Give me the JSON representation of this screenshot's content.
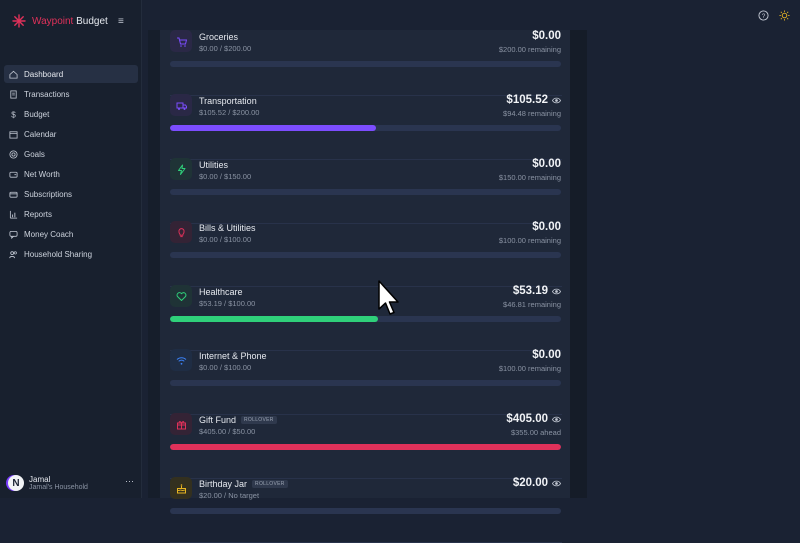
{
  "brand": {
    "name_accent": "Waypoint",
    "name_rest": " Budget"
  },
  "nav": [
    {
      "label": "Dashboard",
      "icon": "home-icon",
      "active": true
    },
    {
      "label": "Transactions",
      "icon": "receipt-icon"
    },
    {
      "label": "Budget",
      "icon": "dollar-icon"
    },
    {
      "label": "Calendar",
      "icon": "calendar-icon"
    },
    {
      "label": "Goals",
      "icon": "target-icon"
    },
    {
      "label": "Net Worth",
      "icon": "wallet-icon"
    },
    {
      "label": "Subscriptions",
      "icon": "card-icon"
    },
    {
      "label": "Reports",
      "icon": "chart-icon"
    },
    {
      "label": "Money Coach",
      "icon": "chat-icon"
    },
    {
      "label": "Household Sharing",
      "icon": "users-icon"
    }
  ],
  "user": {
    "initial": "N",
    "name": "Jamal",
    "household": "Jamal's Household"
  },
  "categories": [
    {
      "name": "Groceries",
      "spent": "$0.00 / $200.00",
      "amount": "$0.00",
      "remaining": "$200.00 remaining",
      "progress": 0,
      "color": "#7c4dff",
      "icon": "cart-icon",
      "icon_bg": "#2a2846"
    },
    {
      "name": "Transportation",
      "spent": "$105.52 / $200.00",
      "amount": "$105.52",
      "remaining": "$94.48 remaining",
      "progress": 0.5276,
      "color": "#7c4dff",
      "icon": "truck-icon",
      "icon_bg": "#2a2846",
      "eye": true
    },
    {
      "name": "Utilities",
      "spent": "$0.00 / $150.00",
      "amount": "$0.00",
      "remaining": "$150.00 remaining",
      "progress": 0,
      "color": "#2fd07a",
      "icon": "bolt-icon",
      "icon_bg": "#1f3336"
    },
    {
      "name": "Bills & Utilities",
      "spent": "$0.00 / $100.00",
      "amount": "$0.00",
      "remaining": "$100.00 remaining",
      "progress": 0,
      "color": "#e0315a",
      "icon": "bulb-icon",
      "icon_bg": "#342335"
    },
    {
      "name": "Healthcare",
      "spent": "$53.19 / $100.00",
      "amount": "$53.19",
      "remaining": "$46.81 remaining",
      "progress": 0.5319,
      "color": "#2fd07a",
      "icon": "heart-icon",
      "icon_bg": "#1f3336",
      "eye": true
    },
    {
      "name": "Internet & Phone",
      "spent": "$0.00 / $100.00",
      "amount": "$0.00",
      "remaining": "$100.00 remaining",
      "progress": 0,
      "color": "#3b82f6",
      "icon": "wifi-icon",
      "icon_bg": "#1f2d44"
    },
    {
      "name": "Gift Fund",
      "badge": "ROLLOVER",
      "spent": "$405.00 / $50.00",
      "amount": "$405.00",
      "remaining": "$355.00 ahead",
      "progress": 1,
      "color": "#e0315a",
      "icon": "gift-icon",
      "icon_bg": "#342335",
      "eye": true
    },
    {
      "name": "Birthday Jar",
      "badge": "ROLLOVER",
      "spent": "$20.00 / No target",
      "amount": "$20.00",
      "remaining": "",
      "progress": 0,
      "color": "#e6b422",
      "icon": "cake-icon",
      "icon_bg": "#33301f",
      "eye": true
    }
  ],
  "colors": {
    "accent": "#e0315a",
    "purple": "#7c4dff",
    "green": "#2fd07a",
    "pink": "#e0315a"
  }
}
